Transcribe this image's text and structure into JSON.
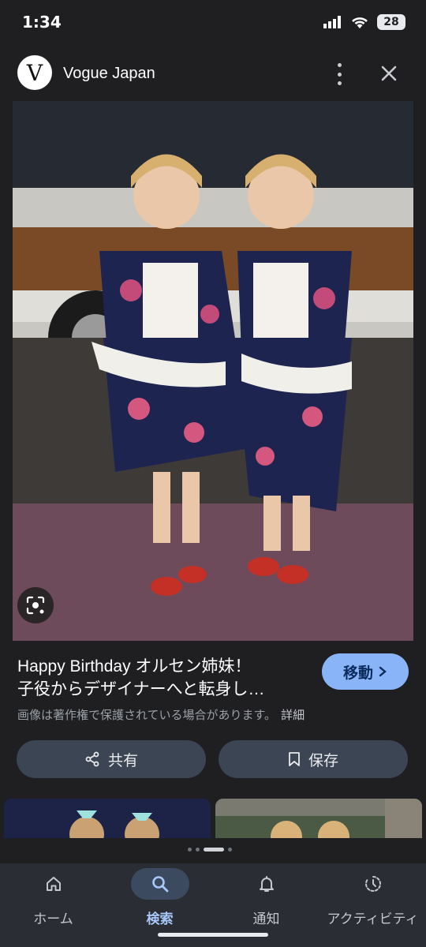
{
  "status_bar": {
    "time": "1:34",
    "battery": "28"
  },
  "header": {
    "logo_letter": "V",
    "site_name": "Vogue Japan"
  },
  "result": {
    "title_line1": "Happy Birthday オルセン姉妹！",
    "title_line2": "子役からデザイナーへと転身し…",
    "go_button": "移動",
    "copyright": "画像は著作権で保護されている場合があります。",
    "detail_link": "詳細"
  },
  "actions": {
    "share": "共有",
    "save": "保存"
  },
  "carousel": {
    "pages": 4,
    "active_index": 2
  },
  "bottom_nav": {
    "items": [
      {
        "label": "ホーム",
        "icon": "home-icon"
      },
      {
        "label": "検索",
        "icon": "search-icon",
        "active": true
      },
      {
        "label": "通知",
        "icon": "bell-icon"
      },
      {
        "label": "アクティビティ",
        "icon": "activity-icon"
      }
    ]
  },
  "colors": {
    "accent": "#8ab4f8",
    "background": "#1f1f22",
    "nav_active": "#a8c7fa"
  }
}
